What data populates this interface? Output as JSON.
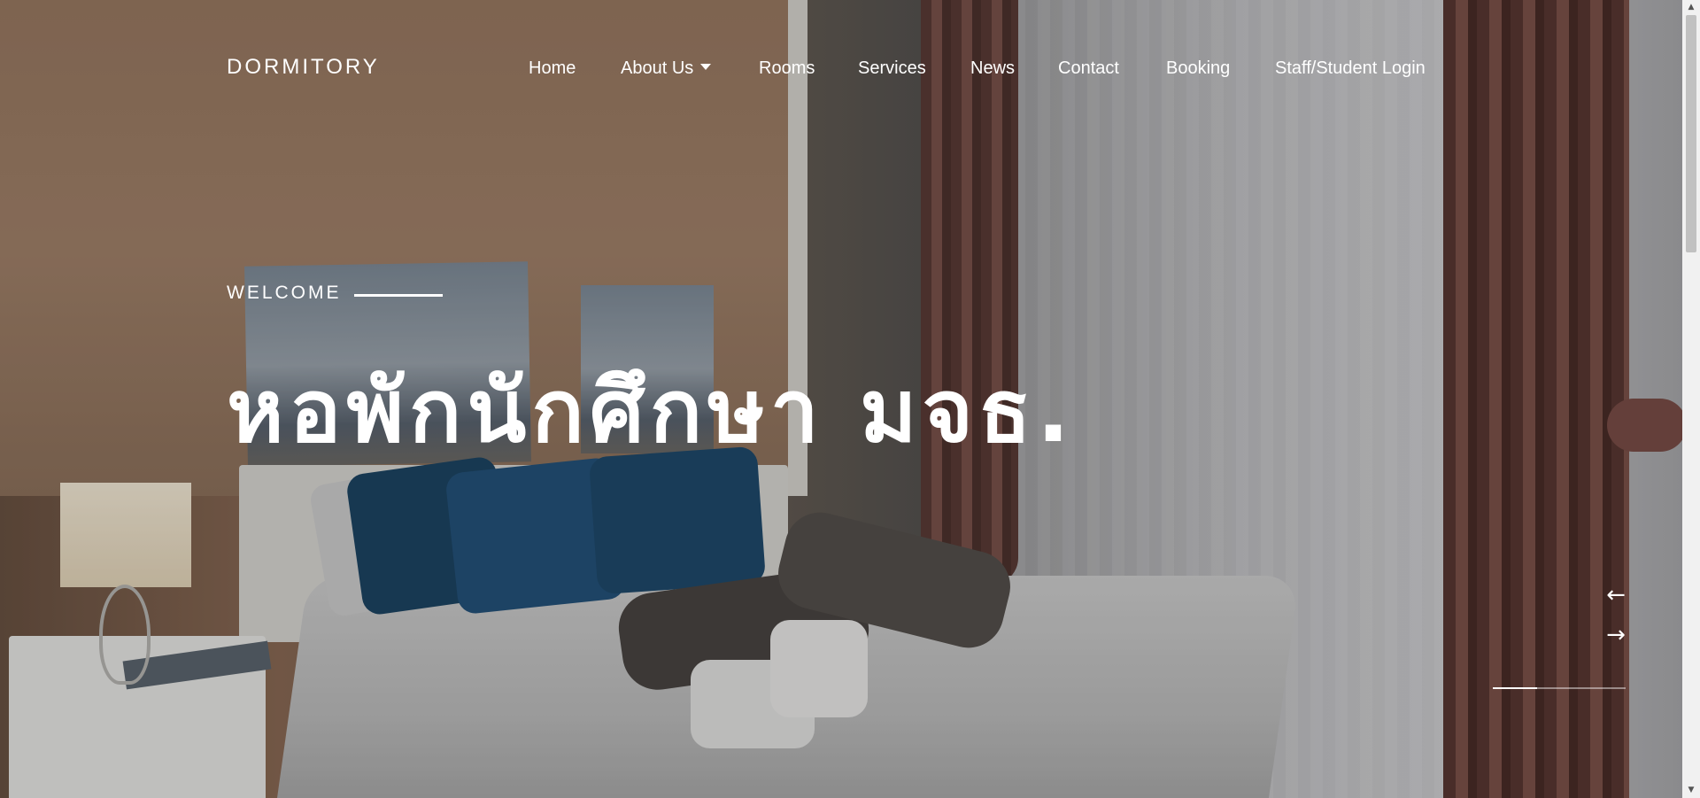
{
  "nav": {
    "brand": "DORMITORY",
    "items": [
      {
        "label": "Home"
      },
      {
        "label": "About Us",
        "dropdown": true
      },
      {
        "label": "Rooms"
      },
      {
        "label": "Services"
      },
      {
        "label": "News"
      },
      {
        "label": "Contact"
      },
      {
        "label": "Booking"
      },
      {
        "label": "Staff/Student Login"
      }
    ]
  },
  "hero": {
    "eyebrow": "WELCOME",
    "title": "หอพักนักศึกษา มจธ.",
    "prev_arrow": "←",
    "next_arrow": "→",
    "slide_progress": 0.33
  },
  "scrollbar": {
    "up": "▲",
    "down": "▼"
  },
  "colors": {
    "text": "#ffffff",
    "overlay": "rgba(0,0,0,0.18)"
  }
}
